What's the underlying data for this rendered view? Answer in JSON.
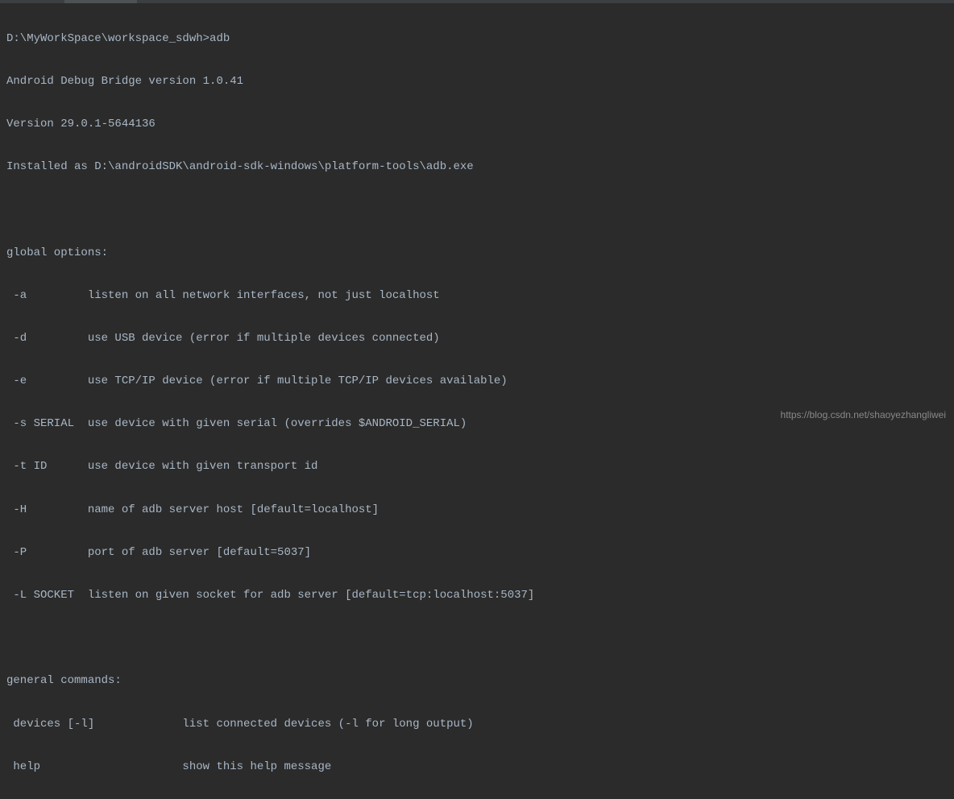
{
  "prompt_line": "D:\\MyWorkSpace\\workspace_sdwh>adb",
  "header": [
    "Android Debug Bridge version 1.0.41",
    "Version 29.0.1-5644136",
    "Installed as D:\\androidSDK\\android-sdk-windows\\platform-tools\\adb.exe"
  ],
  "global_title": "global options:",
  "global_options": [
    " -a         listen on all network interfaces, not just localhost",
    " -d         use USB device (error if multiple devices connected)",
    " -e         use TCP/IP device (error if multiple TCP/IP devices available)",
    " -s SERIAL  use device with given serial (overrides $ANDROID_SERIAL)",
    " -t ID      use device with given transport id",
    " -H         name of adb server host [default=localhost]",
    " -P         port of adb server [default=5037]",
    " -L SOCKET  listen on given socket for adb server [default=tcp:localhost:5037]"
  ],
  "general_title": "general commands:",
  "general_commands": [
    " devices [-l]             list connected devices (-l for long output)",
    " help                     show this help message"
  ],
  "watermark": "https://blog.csdn.net/shaoyezhangliwei"
}
